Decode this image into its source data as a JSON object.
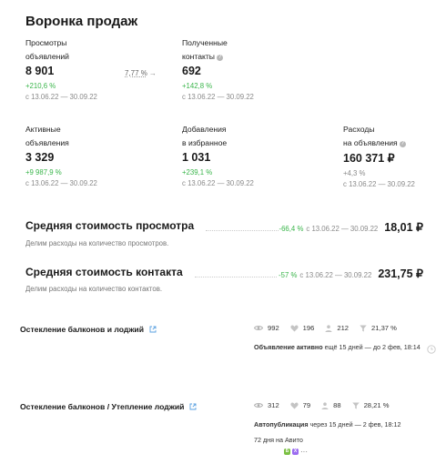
{
  "page_title": "Воронка продаж",
  "metrics": {
    "views": {
      "label_line1": "Просмотры",
      "label_line2": "объявлений",
      "value": "8 901",
      "delta": "+210,6 %",
      "period": "с 13.06.22 — 30.09.22"
    },
    "conversion": {
      "value": "7,77 %"
    },
    "contacts": {
      "label_line1": "Полученные",
      "label_line2": "контакты",
      "value": "692",
      "delta": "+142,8 %",
      "period": "с 13.06.22 — 30.09.22"
    },
    "active": {
      "label_line1": "Активные",
      "label_line2": "объявления",
      "value": "3 329",
      "delta": "+9 987,9 %",
      "period": "с 13.06.22 — 30.09.22"
    },
    "favorites": {
      "label_line1": "Добавления",
      "label_line2": "в избранное",
      "value": "1 031",
      "delta": "+239,1 %",
      "period": "с 13.06.22 — 30.09.22"
    },
    "expenses": {
      "label_line1": "Расходы",
      "label_line2": "на объявления",
      "value": "160 371 ₽",
      "delta": "+4,3 %",
      "period": "с 13.06.22 — 30.09.22"
    }
  },
  "costs": [
    {
      "title": "Средняя стоимость просмотра",
      "delta": "-66,4 %",
      "period": "с 13.06.22 — 30.09.22",
      "value": "18,01 ₽",
      "description": "Делим расходы на количество просмотров."
    },
    {
      "title": "Средняя стоимость контакта",
      "delta": "-57 %",
      "period": "с 13.06.22 — 30.09.22",
      "value": "231,75 ₽",
      "description": "Делим расходы на количество контактов."
    }
  ],
  "ads": [
    {
      "title": "Остекление балконов и лоджий",
      "views": "992",
      "favorites": "196",
      "contacts": "212",
      "conversion": "21,37 %",
      "status_bold": "Объявление активно",
      "status_rest": " ещё 15 дней — до 2 фев, 18:14"
    },
    {
      "title": "Остекление балконов / Утепление лоджий",
      "views": "312",
      "favorites": "79",
      "contacts": "88",
      "conversion": "28,21 %",
      "status_bold": "Автопубликация",
      "status_rest": " через 15 дней — 2 фев, 18:12",
      "extra_line": "72 дня на Авито",
      "badges": [
        "Б",
        "Х"
      ],
      "more": "···"
    }
  ],
  "colors": {
    "positive": "#39b54a",
    "muted": "#8a8a8a",
    "link": "#5aa0e0",
    "badge_green": "#7bc043",
    "badge_purple": "#9b6cf0"
  }
}
